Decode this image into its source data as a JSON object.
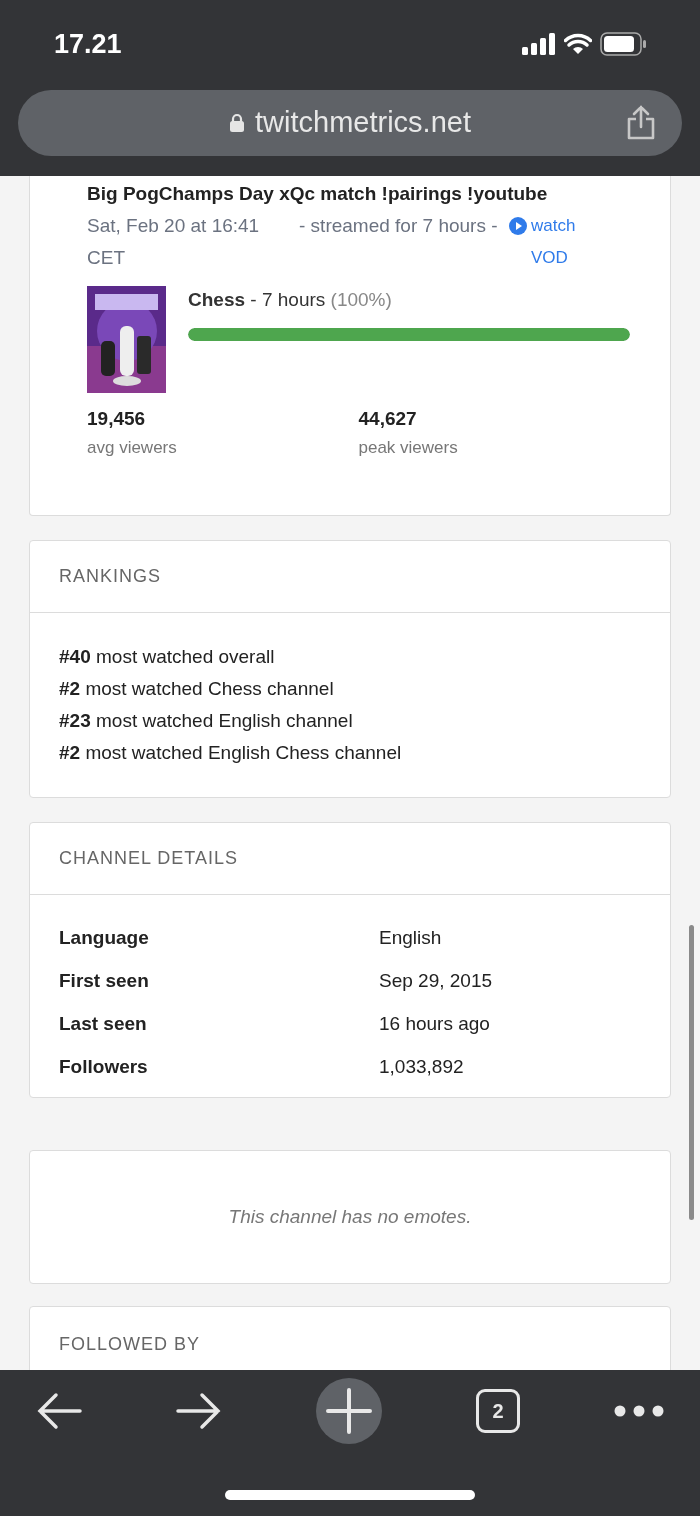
{
  "status_bar": {
    "time": "17.21"
  },
  "address_bar": {
    "url": "twitchmetrics.net"
  },
  "stream": {
    "title": "Big PogChamps Day xQc match !pairings !youtube",
    "date": "Sat, Feb 20 at 16:41 CET",
    "duration": "- streamed for 7 hours -",
    "vod_link": "watch VOD",
    "game": {
      "kind": "picture",
      "name": "Chess",
      "hours": "- 7 hours",
      "share": "(100%)",
      "level": 1.0
    },
    "stats": [
      {
        "value": "19,456",
        "label": "avg viewers"
      },
      {
        "value": "44,627",
        "label": "peak viewers"
      }
    ]
  },
  "rankings": {
    "header": "RANKINGS",
    "items": [
      "**#40** most watched overall",
      "**#2** most watched Chess channel",
      "**#23** most watched English channel",
      "**#2** most watched English Chess channel"
    ]
  },
  "channel_details": {
    "header": "CHANNEL DETAILS",
    "rows": [
      {
        "label": "Language",
        "value": "English"
      },
      {
        "label": "First seen",
        "value": "Sep 29, 2015"
      },
      {
        "label": "Last seen",
        "value": "16 hours ago"
      },
      {
        "label": "Followers",
        "value": "1,033,892"
      }
    ]
  },
  "emotes": {
    "message": "This channel has no emotes."
  },
  "followed_by": {
    "header": "FOLLOWED BY"
  },
  "toolbar": {
    "tab_count": "2"
  }
}
